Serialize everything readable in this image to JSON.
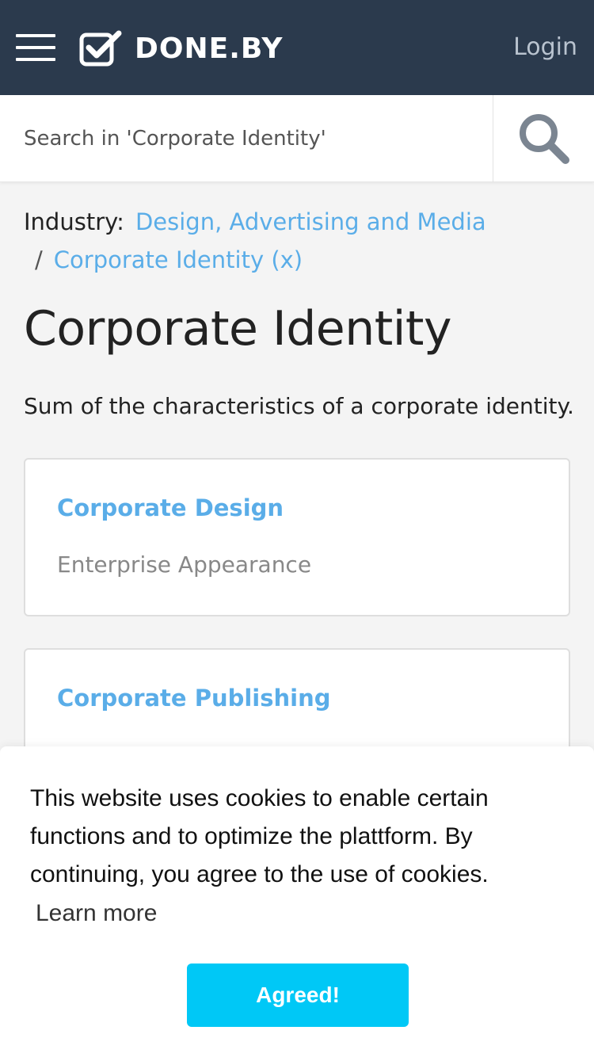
{
  "header": {
    "logo_text": "DONE.BY",
    "login_label": "Login",
    "menu_icon": "hamburger-icon",
    "logo_icon": "checkbox-icon",
    "background_color": "#2b3a4d"
  },
  "search": {
    "placeholder": "Search in 'Corporate Identity'",
    "icon": "search-icon"
  },
  "breadcrumb": {
    "label": "Industry:",
    "items": [
      "Design, Advertising and Media",
      "Corporate Identity (x)"
    ],
    "separator": "/",
    "link_color": "#5aade8"
  },
  "page": {
    "title": "Corporate Identity",
    "description": "Sum of the characteristics of a corporate identity."
  },
  "cards": [
    {
      "title": "Corporate Design",
      "subtitle": "Enterprise Appearance"
    },
    {
      "title": "Corporate Publishing",
      "subtitle": ""
    }
  ],
  "cookie_banner": {
    "text": "This website uses cookies to enable certain functions and to optimize the plattform. By continuing, you agree to the use of cookies.",
    "learn_more": "Learn more",
    "button_label": "Agreed!",
    "button_color": "#00c8f6"
  }
}
